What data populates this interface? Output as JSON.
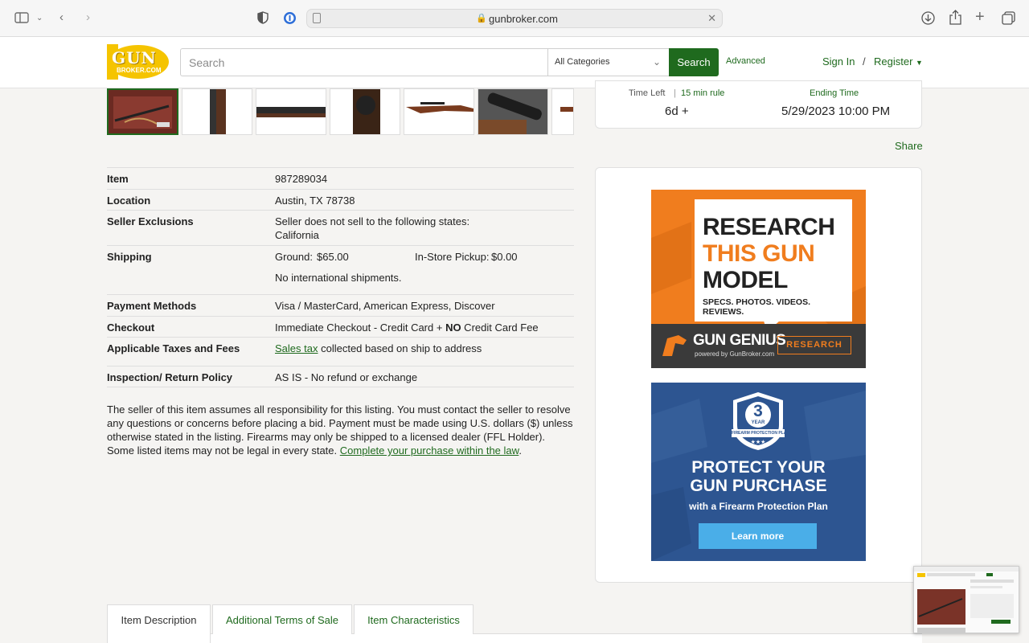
{
  "browser": {
    "url": "gunbroker.com"
  },
  "header": {
    "logo_top": "GUN",
    "logo_bottom": "BROKER.COM",
    "search_placeholder": "Search",
    "category": "All Categories",
    "search_button": "Search",
    "advanced": "Advanced",
    "sign_in": "Sign In",
    "separator": "/",
    "register": "Register"
  },
  "timing": {
    "time_left_label": "Time Left",
    "rule_link": "15 min rule",
    "time_left_value": "6d +",
    "ending_label": "Ending Time",
    "ending_value": "5/29/2023 10:00 PM"
  },
  "share": "Share",
  "details": {
    "item_label": "Item",
    "item_value": "987289034",
    "location_label": "Location",
    "location_value": "Austin, TX 78738",
    "exclusions_label": "Seller Exclusions",
    "exclusions_line1": "Seller does not sell to the following states:",
    "exclusions_line2": "California",
    "shipping_label": "Shipping",
    "ground_label": "Ground:",
    "ground_value": "$65.00",
    "pickup_label": "In-Store Pickup:",
    "pickup_value": "$0.00",
    "international": "No international shipments.",
    "payment_label": "Payment Methods",
    "payment_value": "Visa / MasterCard, American Express, Discover",
    "checkout_label": "Checkout",
    "checkout_pre": "Immediate Checkout - Credit Card + ",
    "checkout_bold": "NO",
    "checkout_post": " Credit Card Fee",
    "taxes_label": "Applicable Taxes and Fees",
    "taxes_link": "Sales tax",
    "taxes_post": " collected based on ship to address",
    "inspection_label": "Inspection/ Return Policy",
    "inspection_value": "AS IS - No refund or exchange"
  },
  "disclaimer": {
    "text": "The seller of this item assumes all responsibility for this listing. You must contact the seller to resolve any questions or concerns before placing a bid. Payment must be made using U.S. dollars ($) unless otherwise stated in the listing. Firearms may only be shipped to a licensed dealer (FFL Holder). Some listed items may not be legal in every state. ",
    "link": "Complete your purchase within the law",
    "end": "."
  },
  "ad_research": {
    "line1": "RESEARCH",
    "line2": "THIS GUN",
    "line3": "MODEL",
    "line4": "SPECS. PHOTOS. VIDEOS. REVIEWS.",
    "brand": "GUN GENIUS",
    "powered": "powered by GunBroker.com",
    "button": "RESEARCH"
  },
  "ad_protect": {
    "badge_number": "3",
    "badge_year": "YEAR",
    "badge_text": "FIREARM PROTECTION PLAN",
    "line1": "PROTECT YOUR",
    "line2": "GUN PURCHASE",
    "line3": "with a Firearm Protection Plan",
    "button": "Learn more"
  },
  "tabs": [
    {
      "label": "Item Description"
    },
    {
      "label": "Additional Terms of Sale"
    },
    {
      "label": "Item Characteristics"
    }
  ],
  "colors": {
    "brand_green": "#1f6a1e",
    "logo_yellow": "#f5c400",
    "ad_orange": "#f07d1e",
    "ad_blue": "#2d5591"
  }
}
